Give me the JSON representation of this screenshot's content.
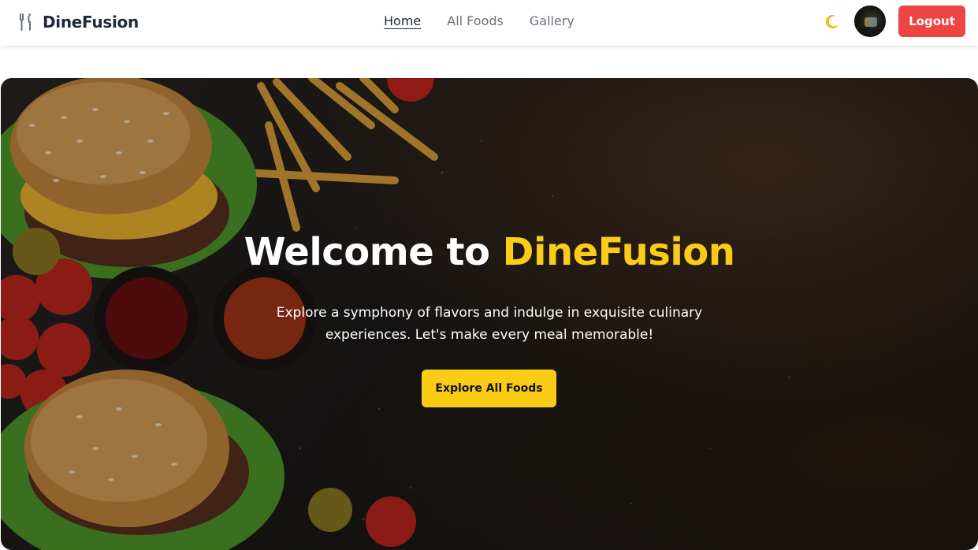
{
  "navbar": {
    "brand_icon": "fork-knife-icon",
    "brand_name": "DineFusion",
    "links": [
      {
        "label": "Home",
        "active": true
      },
      {
        "label": "All Foods",
        "active": false
      },
      {
        "label": "Gallery",
        "active": false
      }
    ],
    "theme_toggle_icon": "moon-icon",
    "logout_label": "Logout"
  },
  "hero": {
    "title_prefix": "Welcome to ",
    "title_accent": "DineFusion",
    "subtitle": "Explore a symphony of flavors and indulge in exquisite culinary experiences. Let's make every meal memorable!",
    "cta_label": "Explore All Foods"
  },
  "colors": {
    "accent_yellow": "#facc15",
    "logout_red": "#ef4444",
    "text_dark": "#1f2937",
    "nav_muted": "#6b7280"
  }
}
